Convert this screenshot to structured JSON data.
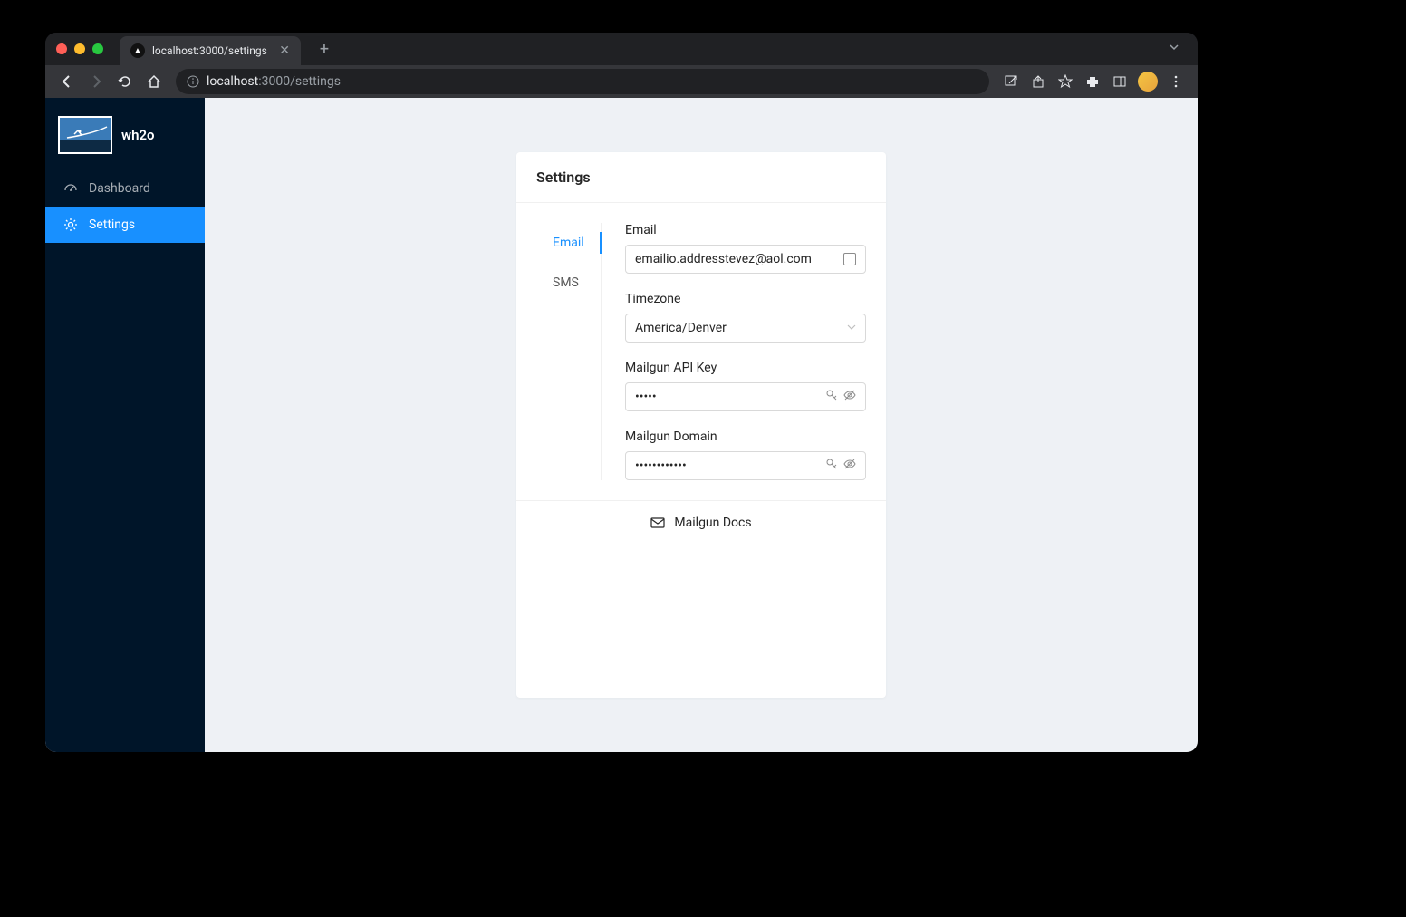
{
  "browser": {
    "tab_title": "localhost:3000/settings",
    "url_host": "localhost",
    "url_port_path": ":3000/settings"
  },
  "app": {
    "name": "wh2o"
  },
  "sidebar": {
    "items": [
      {
        "label": "Dashboard",
        "active": false
      },
      {
        "label": "Settings",
        "active": true
      }
    ]
  },
  "settings": {
    "title": "Settings",
    "tabs": [
      {
        "label": "Email",
        "active": true
      },
      {
        "label": "SMS",
        "active": false
      }
    ],
    "form": {
      "email": {
        "label": "Email",
        "value": "emailio.addresstevez@aol.com"
      },
      "timezone": {
        "label": "Timezone",
        "value": "America/Denver"
      },
      "mailgun_key": {
        "label": "Mailgun API Key",
        "masked": "•••••"
      },
      "mailgun_domain": {
        "label": "Mailgun Domain",
        "masked": "••••••••••••"
      }
    },
    "footer_link": "Mailgun Docs"
  }
}
